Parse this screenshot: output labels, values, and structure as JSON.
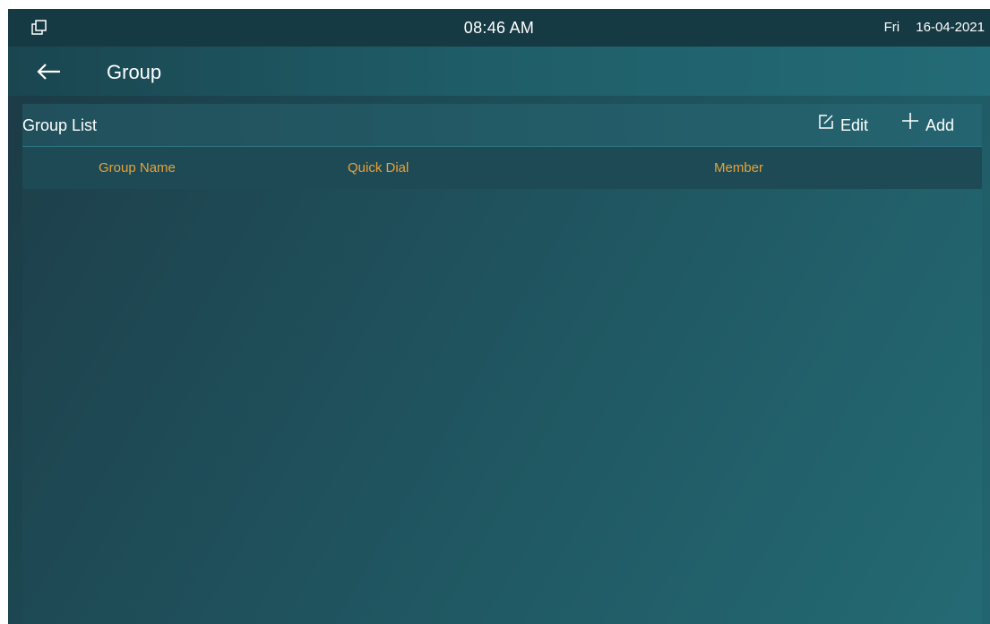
{
  "status_bar": {
    "icon": "window-restore-icon",
    "time": "08:46 AM",
    "day": "Fri",
    "date": "16-04-2021"
  },
  "title_bar": {
    "back_icon": "arrow-left-icon",
    "title": "Group"
  },
  "panel": {
    "title": "Group List",
    "edit_icon": "edit-icon",
    "edit_label": "Edit",
    "add_icon": "plus-icon",
    "add_label": "Add",
    "columns": [
      "Group Name",
      "Quick Dial",
      "Member"
    ],
    "rows": []
  },
  "colors": {
    "accent": "#e8a23a",
    "status_bar": "#163a44",
    "text": "#ffffff"
  }
}
